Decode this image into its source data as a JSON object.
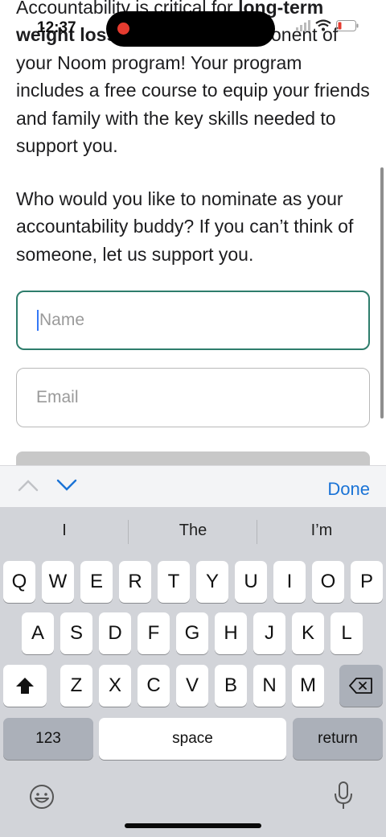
{
  "status": {
    "time": "12:37"
  },
  "content": {
    "p1_part1": "Accountability is critical for ",
    "p1_bold1": "long-term weight loss",
    "p1_part2": " and is a key component of your Noom program! Your program includes a free course to equip your friends and family with the key skills needed to support you.",
    "p2": "Who would you like to nominate as your accountability buddy? If you can’t think of someone, let us support you."
  },
  "form": {
    "name_placeholder": "Name",
    "email_placeholder": "Email"
  },
  "accessory": {
    "done_label": "Done"
  },
  "keyboard": {
    "suggestions": [
      "I",
      "The",
      "I’m"
    ],
    "row1": [
      "Q",
      "W",
      "E",
      "R",
      "T",
      "Y",
      "U",
      "I",
      "O",
      "P"
    ],
    "row2": [
      "A",
      "S",
      "D",
      "F",
      "G",
      "H",
      "J",
      "K",
      "L"
    ],
    "row3": [
      "Z",
      "X",
      "C",
      "V",
      "B",
      "N",
      "M"
    ],
    "numbers_label": "123",
    "space_label": "space",
    "return_label": "return"
  },
  "icons": {
    "shift": "shift-icon",
    "delete": "backspace-icon",
    "emoji": "emoji-icon",
    "mic": "microphone-icon",
    "prev": "chevron-up-icon",
    "next": "chevron-down-icon"
  }
}
